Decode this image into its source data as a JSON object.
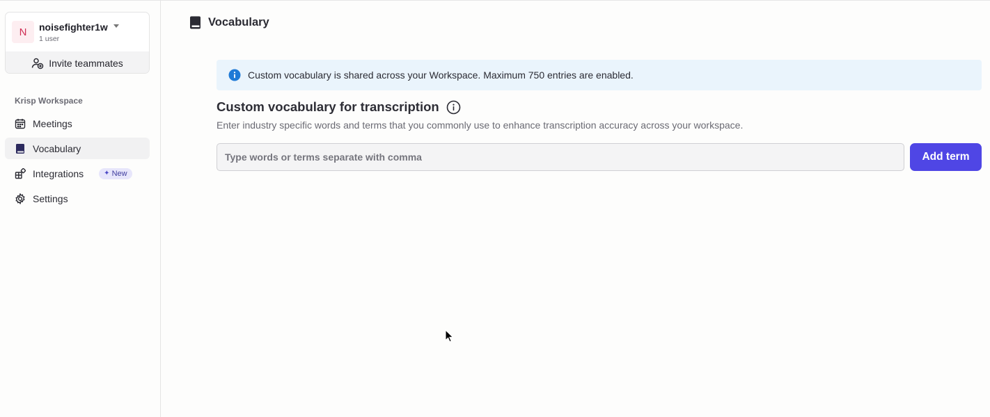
{
  "workspace": {
    "avatar_letter": "N",
    "name": "noisefighter1w",
    "user_count": "1 user",
    "invite_label": "Invite teammates"
  },
  "sidebar": {
    "section_label": "Krisp Workspace",
    "items": [
      {
        "label": "Meetings",
        "icon": "calendar-icon",
        "active": false
      },
      {
        "label": "Vocabulary",
        "icon": "book-icon",
        "active": true
      },
      {
        "label": "Integrations",
        "icon": "puzzle-icon",
        "active": false,
        "badge": "New"
      },
      {
        "label": "Settings",
        "icon": "gear-icon",
        "active": false
      }
    ]
  },
  "header": {
    "title": "Vocabulary",
    "icon": "book-icon"
  },
  "banner": {
    "text": "Custom vocabulary is shared across your Workspace. Maximum 750 entries are enabled.",
    "icon": "info-icon"
  },
  "vocabulary_section": {
    "title": "Custom vocabulary for transcription",
    "description": "Enter industry specific words and terms that you commonly use to enhance transcription accuracy across your workspace.",
    "input_placeholder": "Type words or terms separate with comma",
    "input_value": "",
    "add_button_label": "Add term"
  },
  "colors": {
    "accent": "#4f46e5",
    "banner_bg": "#eaf4fc",
    "info_icon": "#1f7ad6",
    "avatar_bg": "#fdeef1",
    "avatar_text": "#cf2f55",
    "badge_bg": "#e7e6fb"
  }
}
